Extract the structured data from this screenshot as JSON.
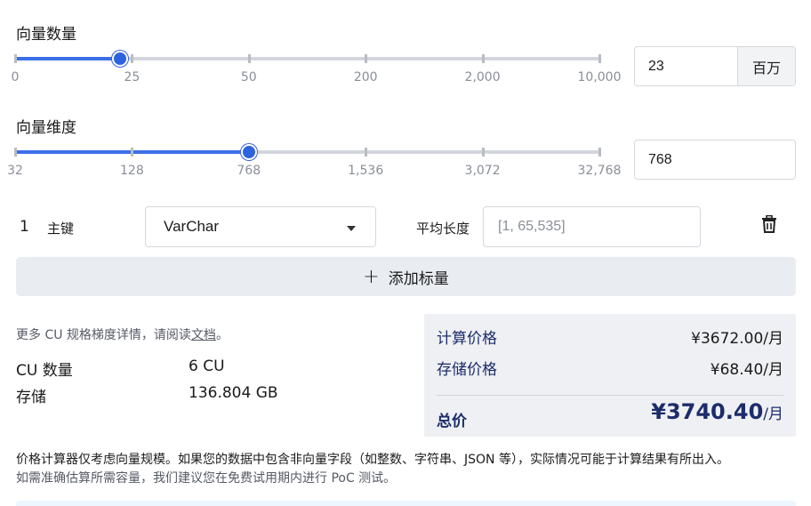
{
  "vector_count": {
    "label": "向量数量",
    "value": "23",
    "unit": "百万",
    "ticks": [
      "0",
      "25",
      "50",
      "200",
      "2,000",
      "10,000"
    ],
    "selected_fraction": 0.18
  },
  "vector_dim": {
    "label": "向量维度",
    "value": "768",
    "ticks": [
      "32",
      "128",
      "768",
      "1,536",
      "3,072",
      "32,768"
    ],
    "selected_fraction": 0.4
  },
  "field": {
    "index": "1",
    "name": "主键",
    "type": "VarChar",
    "avg_length_label": "平均长度",
    "avg_length_placeholder": "[1, 65,535]"
  },
  "add_scalar_label": "添加标量",
  "info": {
    "prefix": "更多 CU 规格梯度详情，请阅读",
    "link": "文档",
    "suffix": "。"
  },
  "specs": {
    "cu_label": "CU 数量",
    "cu_value": "6 CU",
    "storage_label": "存储",
    "storage_value": "136.804 GB"
  },
  "pricing": {
    "compute_label": "计算价格",
    "compute_value": "¥3672.00/月",
    "storage_label": "存储价格",
    "storage_value": "¥68.40/月",
    "total_label": "总价",
    "total_value": "¥3740.40",
    "total_per": "/月"
  },
  "disclaimer": {
    "line1": "价格计算器仅考虑向量规模。如果您的数据中包含非向量字段（如整数、字符串、JSON 等），实际情况可能于计算结果有所出入。",
    "line2": "如需准确估算所需容量，我们建议您在免费试用期内进行 PoC 测试。"
  },
  "icons": {
    "delete": "trash-icon",
    "add": "plus-icon",
    "dropdown": "caret-down-icon"
  },
  "colors": {
    "accent": "#2f63de",
    "price_text": "#1c2c6b",
    "panel_bg": "#eef0f3"
  }
}
